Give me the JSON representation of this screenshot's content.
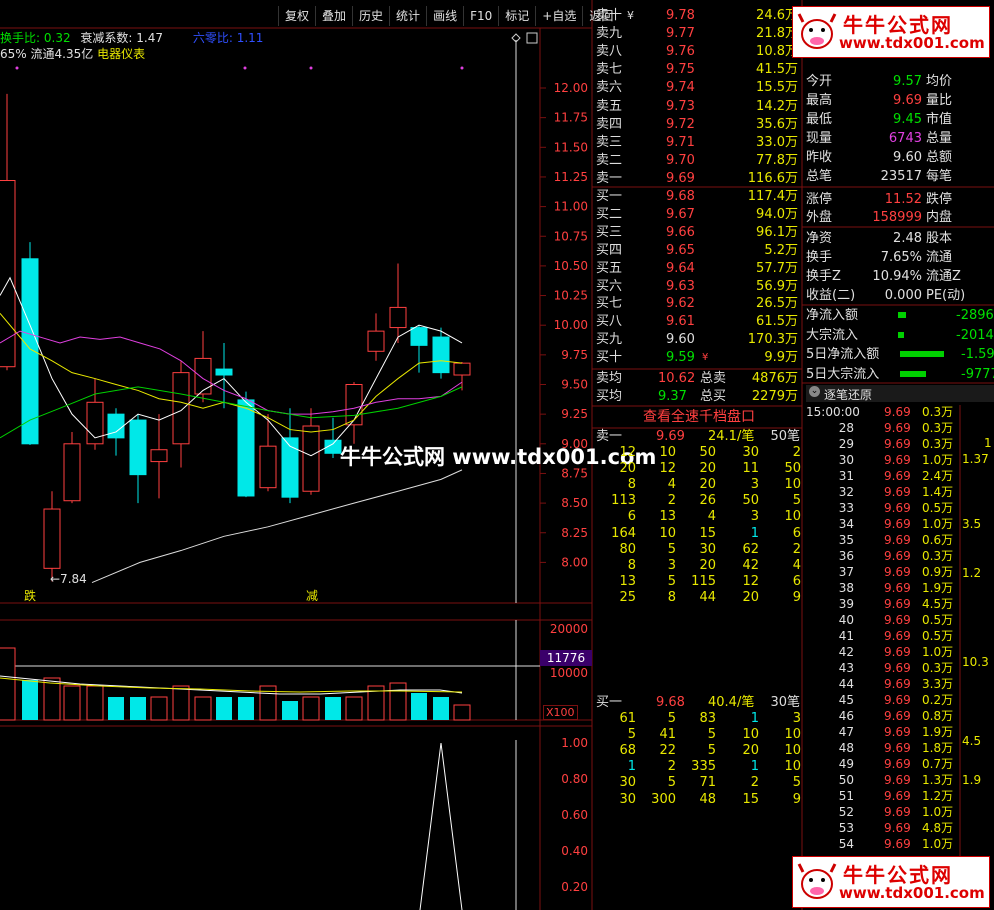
{
  "toolbar": [
    "复权",
    "叠加",
    "历史",
    "统计",
    "画线",
    "F10",
    "标记",
    "+自选",
    "返回"
  ],
  "indicator_line": {
    "label1": "换手比:",
    "val1": "0.32",
    "label2": "衰减系数:",
    "val2": "1.47",
    "label3": "六零比:",
    "val3": "1.11"
  },
  "stock_line": {
    "pct": "65%",
    "flow": "流通4.35亿",
    "sector": "电器仪表"
  },
  "price_ticks": [
    "12.00",
    "11.75",
    "11.50",
    "11.25",
    "11.00",
    "10.75",
    "10.50",
    "10.25",
    "10.00",
    "9.75",
    "9.50",
    "9.25",
    "9.00",
    "8.75",
    "8.50",
    "8.25",
    "8.00"
  ],
  "low_label": "←7.84",
  "marker_left": "跌",
  "marker_right": "减",
  "vol_ticks": [
    "20000",
    "10000"
  ],
  "vol_current": "11776",
  "vol_unit": "X100",
  "lower_ticks": [
    "1.00",
    "0.80",
    "0.60",
    "0.40",
    "0.20"
  ],
  "watermark_center": "牛牛公式网 www.tdx001.com",
  "logo_text": "牛牛公式网",
  "logo_url": "www.tdx001.com",
  "asks": [
    {
      "label": "卖十",
      "mark": "¥",
      "price": "9.78",
      "vol": "24.6万"
    },
    {
      "label": "卖九",
      "mark": "",
      "price": "9.77",
      "vol": "21.8万"
    },
    {
      "label": "卖八",
      "mark": "",
      "price": "9.76",
      "vol": "10.8万"
    },
    {
      "label": "卖七",
      "mark": "",
      "price": "9.75",
      "vol": "41.5万"
    },
    {
      "label": "卖六",
      "mark": "",
      "price": "9.74",
      "vol": "15.5万"
    },
    {
      "label": "卖五",
      "mark": "",
      "price": "9.73",
      "vol": "14.2万"
    },
    {
      "label": "卖四",
      "mark": "",
      "price": "9.72",
      "vol": "35.6万"
    },
    {
      "label": "卖三",
      "mark": "",
      "price": "9.71",
      "vol": "33.0万"
    },
    {
      "label": "卖二",
      "mark": "",
      "price": "9.70",
      "vol": "77.8万"
    },
    {
      "label": "卖一",
      "mark": "",
      "price": "9.69",
      "vol": "116.6万"
    }
  ],
  "bids": [
    {
      "label": "买一",
      "price": "9.68",
      "vol": "117.4万"
    },
    {
      "label": "买二",
      "price": "9.67",
      "vol": "94.0万"
    },
    {
      "label": "买三",
      "price": "9.66",
      "vol": "96.1万"
    },
    {
      "label": "买四",
      "price": "9.65",
      "vol": "5.2万"
    },
    {
      "label": "买五",
      "price": "9.64",
      "vol": "57.7万"
    },
    {
      "label": "买六",
      "price": "9.63",
      "vol": "56.9万"
    },
    {
      "label": "买七",
      "price": "9.62",
      "vol": "26.5万"
    },
    {
      "label": "买八",
      "price": "9.61",
      "vol": "61.5万"
    },
    {
      "label": "买九",
      "price": "9.60",
      "vol": "170.3万"
    },
    {
      "label": "买十",
      "price": "9.59",
      "mark": "¥",
      "vol": "9.9万"
    }
  ],
  "avg": [
    {
      "label": "卖均",
      "price": "10.62",
      "label2": "总卖",
      "vol": "4876万"
    },
    {
      "label": "买均",
      "price": "9.37",
      "label2": "总买",
      "vol": "2279万"
    }
  ],
  "queue_btn": "查看全速千档盘口",
  "sell_queue": {
    "label": "卖一",
    "price": "9.69",
    "avg": "24.1/笔",
    "count": "50笔",
    "rows": [
      [
        "12",
        "10",
        "50",
        "30",
        "2"
      ],
      [
        "20",
        "12",
        "20",
        "11",
        "50"
      ],
      [
        "8",
        "4",
        "20",
        "3",
        "10"
      ],
      [
        "113",
        "2",
        "26",
        "50",
        "5"
      ],
      [
        "6",
        "13",
        "4",
        "3",
        "10"
      ],
      [
        "164",
        "10",
        "15",
        "1",
        "6"
      ],
      [
        "80",
        "5",
        "30",
        "62",
        "2"
      ],
      [
        "8",
        "3",
        "20",
        "42",
        "4"
      ],
      [
        "13",
        "5",
        "115",
        "12",
        "6"
      ],
      [
        "25",
        "8",
        "44",
        "20",
        "9"
      ]
    ]
  },
  "buy_queue": {
    "label": "买一",
    "price": "9.68",
    "avg": "40.4/笔",
    "count": "30笔",
    "rows": [
      [
        "61",
        "5",
        "83",
        "1",
        "3"
      ],
      [
        "5",
        "41",
        "5",
        "10",
        "10"
      ],
      [
        "68",
        "22",
        "5",
        "20",
        "10"
      ],
      [
        "1",
        "2",
        "335",
        "1",
        "10"
      ],
      [
        "30",
        "5",
        "71",
        "2",
        "5"
      ],
      [
        "30",
        "300",
        "48",
        "15",
        "9"
      ]
    ]
  },
  "info": [
    {
      "l1": "今开",
      "v1": "9.57",
      "c1": "g",
      "l2": "均价"
    },
    {
      "l1": "最高",
      "v1": "9.69",
      "c1": "r",
      "l2": "量比"
    },
    {
      "l1": "最低",
      "v1": "9.45",
      "c1": "g",
      "l2": "市值"
    },
    {
      "l1": "现量",
      "v1": "6743",
      "c1": "p",
      "l2": "总量"
    },
    {
      "l1": "昨收",
      "v1": "9.60",
      "c1": "w",
      "l2": "总额"
    },
    {
      "l1": "总笔",
      "v1": "23517",
      "c1": "w",
      "l2": "每笔"
    },
    {
      "l1": "涨停",
      "v1": "11.52",
      "c1": "r",
      "l2": "跌停"
    },
    {
      "l1": "外盘",
      "v1": "158999",
      "c1": "r",
      "l2": "内盘"
    },
    {
      "l1": "净资",
      "v1": "2.48",
      "c1": "w",
      "l2": "股本"
    },
    {
      "l1": "换手",
      "v1": "7.65%",
      "c1": "w",
      "l2": "流通"
    },
    {
      "l1": "换手Z",
      "v1": "10.94%",
      "c1": "w",
      "l2": "流通Z"
    },
    {
      "l1": "收益(二)",
      "v1": "0.000",
      "c1": "w",
      "l2": "PE(动)"
    }
  ],
  "flows": [
    {
      "label": "净流入额",
      "value": "-2896"
    },
    {
      "label": "大宗流入",
      "value": "-2014"
    },
    {
      "label": "5日净流入额",
      "value": "-1.59"
    },
    {
      "label": "5日大宗流入",
      "value": "-9777"
    }
  ],
  "ticks_header": "逐笔还原",
  "ticks": [
    {
      "t": "15:00:00",
      "p": "9.69",
      "v": "0.3万"
    },
    {
      "t": "28",
      "p": "9.69",
      "v": "0.3万"
    },
    {
      "t": "29",
      "p": "9.69",
      "v": "0.3万"
    },
    {
      "t": "30",
      "p": "9.69",
      "v": "1.0万"
    },
    {
      "t": "31",
      "p": "9.69",
      "v": "2.4万"
    },
    {
      "t": "32",
      "p": "9.69",
      "v": "1.4万"
    },
    {
      "t": "33",
      "p": "9.69",
      "v": "0.5万"
    },
    {
      "t": "34",
      "p": "9.69",
      "v": "1.0万"
    },
    {
      "t": "35",
      "p": "9.69",
      "v": "0.6万"
    },
    {
      "t": "36",
      "p": "9.69",
      "v": "0.3万"
    },
    {
      "t": "37",
      "p": "9.69",
      "v": "0.9万"
    },
    {
      "t": "38",
      "p": "9.69",
      "v": "1.9万"
    },
    {
      "t": "39",
      "p": "9.69",
      "v": "4.5万"
    },
    {
      "t": "40",
      "p": "9.69",
      "v": "0.5万"
    },
    {
      "t": "41",
      "p": "9.69",
      "v": "0.5万"
    },
    {
      "t": "42",
      "p": "9.69",
      "v": "1.0万"
    },
    {
      "t": "43",
      "p": "9.69",
      "v": "0.3万"
    },
    {
      "t": "44",
      "p": "9.69",
      "v": "3.3万"
    },
    {
      "t": "45",
      "p": "9.69",
      "v": "0.2万"
    },
    {
      "t": "46",
      "p": "9.69",
      "v": "0.8万"
    },
    {
      "t": "47",
      "p": "9.69",
      "v": "1.9万"
    },
    {
      "t": "48",
      "p": "9.69",
      "v": "1.8万"
    },
    {
      "t": "49",
      "p": "9.69",
      "v": "0.7万"
    },
    {
      "t": "50",
      "p": "9.69",
      "v": "1.3万"
    },
    {
      "t": "51",
      "p": "9.69",
      "v": "1.2万"
    },
    {
      "t": "52",
      "p": "9.69",
      "v": "1.0万"
    },
    {
      "t": "53",
      "p": "9.69",
      "v": "4.8万"
    },
    {
      "t": "54",
      "p": "9.69",
      "v": "1.0万"
    }
  ],
  "tick_side": [
    "1",
    "1.37",
    "3.5",
    "1.2",
    "10.3",
    "4.5",
    "1.9"
  ],
  "colors": {
    "up": "#ff4040",
    "down": "#00e8e8",
    "grid": "#7a1010",
    "bg": "#000000"
  }
}
